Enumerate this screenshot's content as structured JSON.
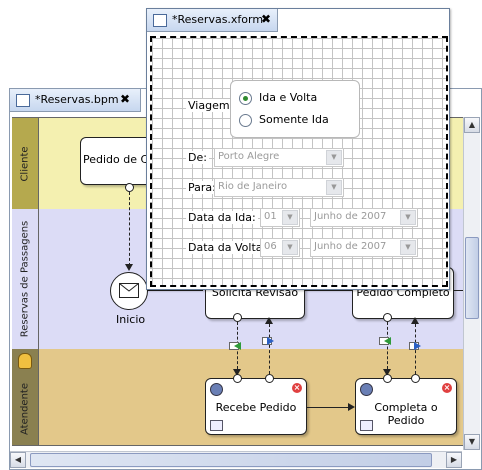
{
  "bpm": {
    "tab_title": "*Reservas.bpm",
    "close_glyph": "✖",
    "lanes": {
      "cliente": "Cliente",
      "reservas": "Reservas de Passagens",
      "atendente": "Atendente"
    },
    "tasks": {
      "pedido": "Pedido de Co",
      "inicio": "Inicio",
      "solicita": "Solicita Revisão",
      "pedido_completo": "Pedido Completo",
      "recebe": "Recebe Pedido",
      "completa": "Completa o Pedido"
    }
  },
  "xform": {
    "tab_title": "*Reservas.xform",
    "close_glyph": "✖",
    "viagem_label": "Viagem:",
    "option_ida_volta": "Ida e Volta",
    "option_somente_ida": "Somente Ida",
    "de_label": "De:",
    "de_value": "Porto Alegre",
    "para_label": "Para:",
    "para_value": "Rio de Janeiro",
    "data_ida_label": "Data da Ida:",
    "data_ida_day": "01",
    "data_ida_month": "Junho de 2007",
    "data_volta_label": "Data da Volta:",
    "data_volta_day": "06",
    "data_volta_month": "Junho de 2007"
  }
}
